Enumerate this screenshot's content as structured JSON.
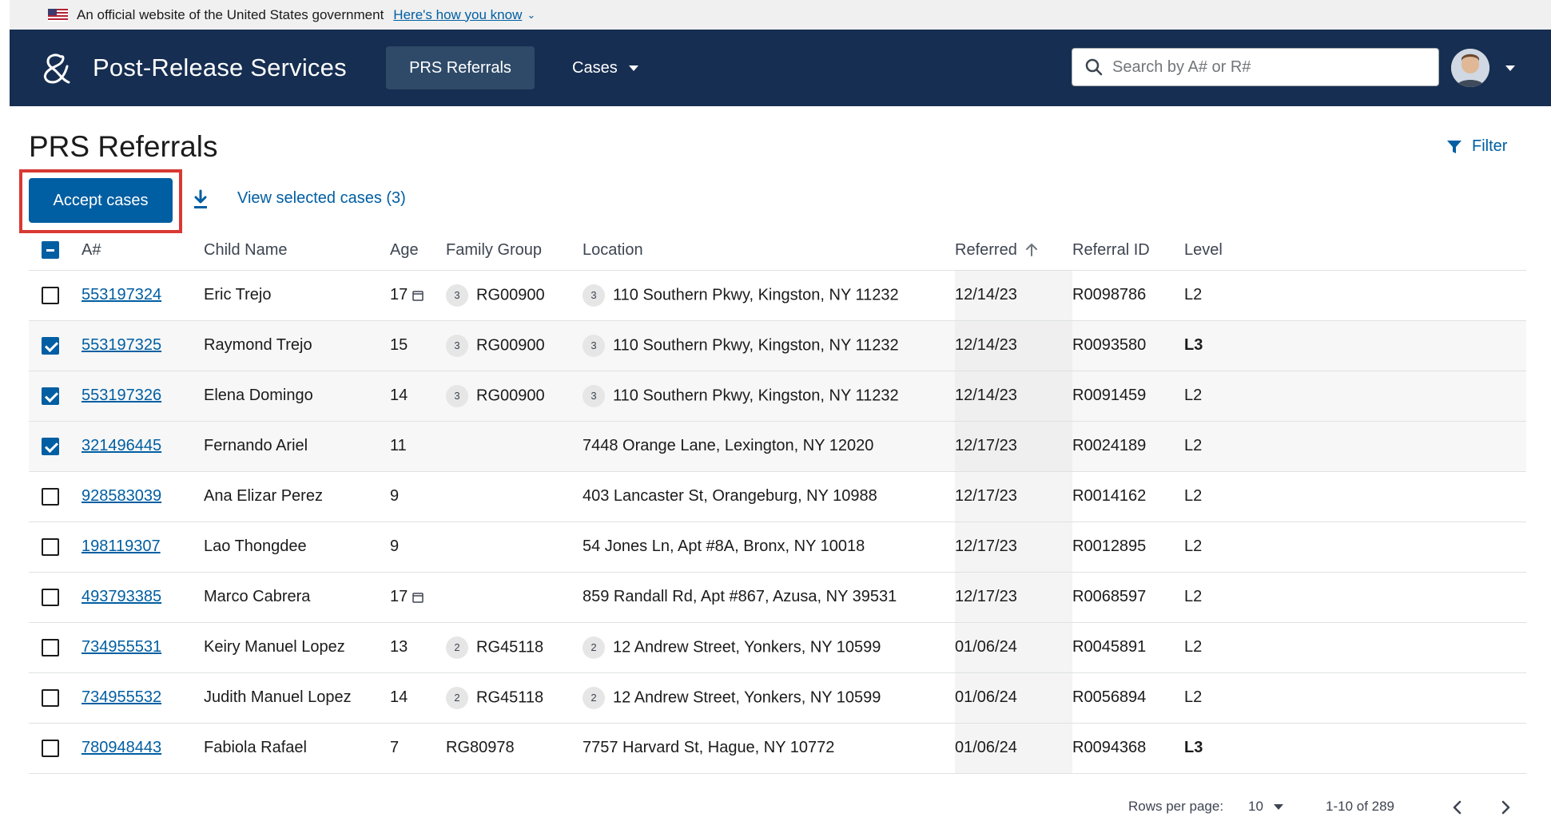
{
  "banner": {
    "text": "An official website of the United States government",
    "link": "Here's how you know"
  },
  "header": {
    "app_title": "Post-Release Services",
    "nav_prs": "PRS Referrals",
    "nav_cases": "Cases",
    "search_placeholder": "Search by A# or R#"
  },
  "page": {
    "title": "PRS Referrals",
    "filter_label": "Filter",
    "accept_label": "Accept cases",
    "view_selected_label": "View selected cases (3)"
  },
  "table": {
    "headers": {
      "anum": "A#",
      "child_name": "Child Name",
      "age": "Age",
      "family_group": "Family Group",
      "location": "Location",
      "referred": "Referred",
      "referral_id": "Referral ID",
      "level": "Level"
    },
    "rows": [
      {
        "checked": false,
        "anum": "553197324",
        "name": "Eric Trejo",
        "age": "17",
        "age_calendar": true,
        "fg_count": "3",
        "family_group": "RG00900",
        "loc_count": "3",
        "location": "110 Southern Pkwy, Kingston, NY 11232",
        "referred": "12/14/23",
        "referral_id": "R0098786",
        "level": "L2",
        "level_bold": false
      },
      {
        "checked": true,
        "anum": "553197325",
        "name": "Raymond Trejo",
        "age": "15",
        "age_calendar": false,
        "fg_count": "3",
        "family_group": "RG00900",
        "loc_count": "3",
        "location": "110 Southern Pkwy, Kingston, NY 11232",
        "referred": "12/14/23",
        "referral_id": "R0093580",
        "level": "L3",
        "level_bold": true
      },
      {
        "checked": true,
        "anum": "553197326",
        "name": "Elena Domingo",
        "age": "14",
        "age_calendar": false,
        "fg_count": "3",
        "family_group": "RG00900",
        "loc_count": "3",
        "location": "110 Southern Pkwy, Kingston, NY 11232",
        "referred": "12/14/23",
        "referral_id": "R0091459",
        "level": "L2",
        "level_bold": false
      },
      {
        "checked": true,
        "anum": "321496445",
        "name": "Fernando Ariel",
        "age": "11",
        "age_calendar": false,
        "fg_count": "",
        "family_group": "",
        "loc_count": "",
        "location": "7448 Orange Lane, Lexington, NY 12020",
        "referred": "12/17/23",
        "referral_id": "R0024189",
        "level": "L2",
        "level_bold": false
      },
      {
        "checked": false,
        "anum": "928583039",
        "name": "Ana Elizar Perez",
        "age": "9",
        "age_calendar": false,
        "fg_count": "",
        "family_group": "",
        "loc_count": "",
        "location": "403 Lancaster St, Orangeburg, NY 10988",
        "referred": "12/17/23",
        "referral_id": "R0014162",
        "level": "L2",
        "level_bold": false
      },
      {
        "checked": false,
        "anum": "198119307",
        "name": "Lao Thongdee",
        "age": "9",
        "age_calendar": false,
        "fg_count": "",
        "family_group": "",
        "loc_count": "",
        "location": "54 Jones Ln, Apt #8A, Bronx, NY 10018",
        "referred": "12/17/23",
        "referral_id": "R0012895",
        "level": "L2",
        "level_bold": false
      },
      {
        "checked": false,
        "anum": "493793385",
        "name": "Marco Cabrera",
        "age": "17",
        "age_calendar": true,
        "fg_count": "",
        "family_group": "",
        "loc_count": "",
        "location": "859 Randall Rd, Apt #867, Azusa, NY 39531",
        "referred": "12/17/23",
        "referral_id": "R0068597",
        "level": "L2",
        "level_bold": false
      },
      {
        "checked": false,
        "anum": "734955531",
        "name": "Keiry Manuel Lopez",
        "age": "13",
        "age_calendar": false,
        "fg_count": "2",
        "family_group": "RG45118",
        "loc_count": "2",
        "location": "12 Andrew Street, Yonkers, NY 10599",
        "referred": "01/06/24",
        "referral_id": "R0045891",
        "level": "L2",
        "level_bold": false
      },
      {
        "checked": false,
        "anum": "734955532",
        "name": "Judith Manuel Lopez",
        "age": "14",
        "age_calendar": false,
        "fg_count": "2",
        "family_group": "RG45118",
        "loc_count": "2",
        "location": "12 Andrew Street, Yonkers, NY 10599",
        "referred": "01/06/24",
        "referral_id": "R0056894",
        "level": "L2",
        "level_bold": false
      },
      {
        "checked": false,
        "anum": "780948443",
        "name": "Fabiola Rafael",
        "age": "7",
        "age_calendar": false,
        "fg_count": "",
        "family_group": "RG80978",
        "loc_count": "",
        "location": "7757 Harvard St, Hague, NY 10772",
        "referred": "01/06/24",
        "referral_id": "R0094368",
        "level": "L3",
        "level_bold": true
      }
    ]
  },
  "pagination": {
    "rows_label": "Rows per page:",
    "rows_value": "10",
    "range": "1-10 of 289"
  },
  "colors": {
    "header_bg": "#162e51",
    "primary": "#005ea2",
    "highlight": "#d83933"
  }
}
